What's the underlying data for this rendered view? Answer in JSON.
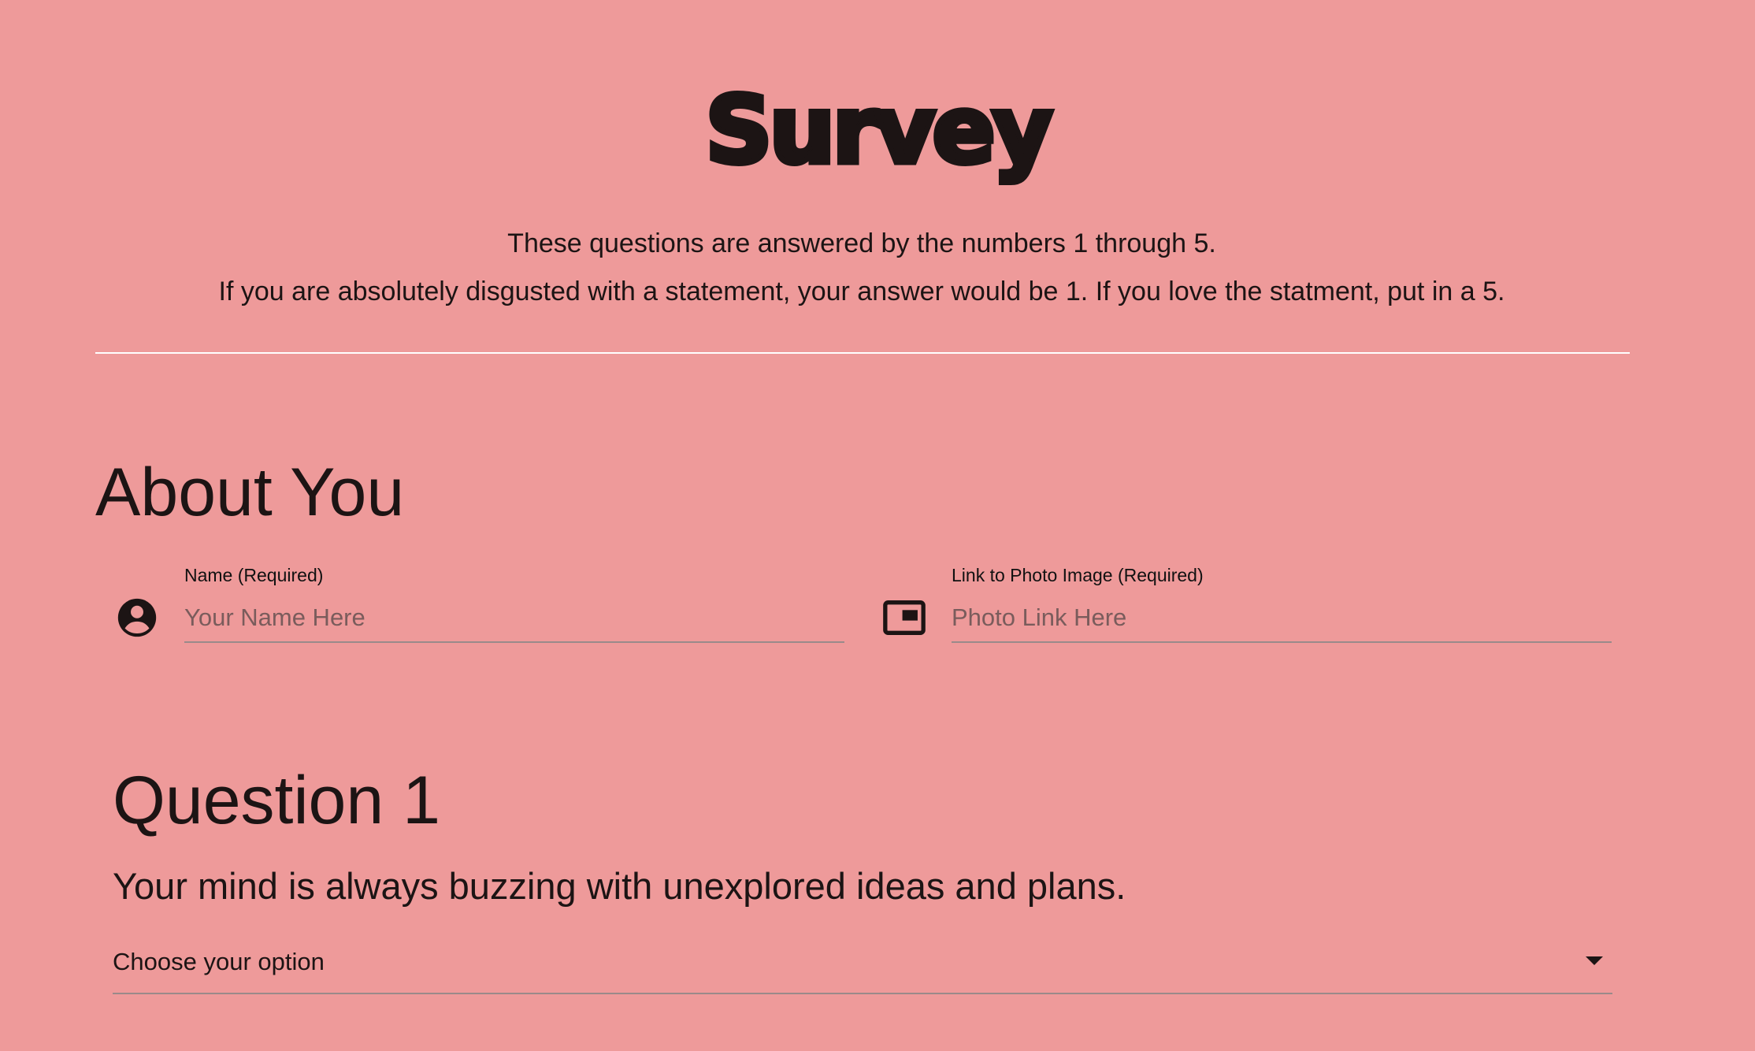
{
  "header": {
    "title": "Survey",
    "intro_line1": "These questions are answered by the numbers 1 through 5.",
    "intro_line2": "If you are absolutely disgusted with a statement, your answer would be 1. If you love the statment, put in a 5."
  },
  "about_section": {
    "heading": "About You",
    "name_field": {
      "label": "Name (Required)",
      "placeholder": "Your Name Here",
      "value": "",
      "icon": "account-circle-icon"
    },
    "photo_field": {
      "label": "Link to Photo Image (Required)",
      "placeholder": "Photo Link Here",
      "value": "",
      "icon": "picture-in-picture-icon"
    }
  },
  "question1": {
    "heading": "Question 1",
    "statement": "Your mind is always buzzing with unexplored ideas and plans.",
    "select": {
      "selected": "Choose your option"
    }
  },
  "colors": {
    "background": "#ee9a9a",
    "text": "#1c1414",
    "divider": "#ffffff"
  }
}
